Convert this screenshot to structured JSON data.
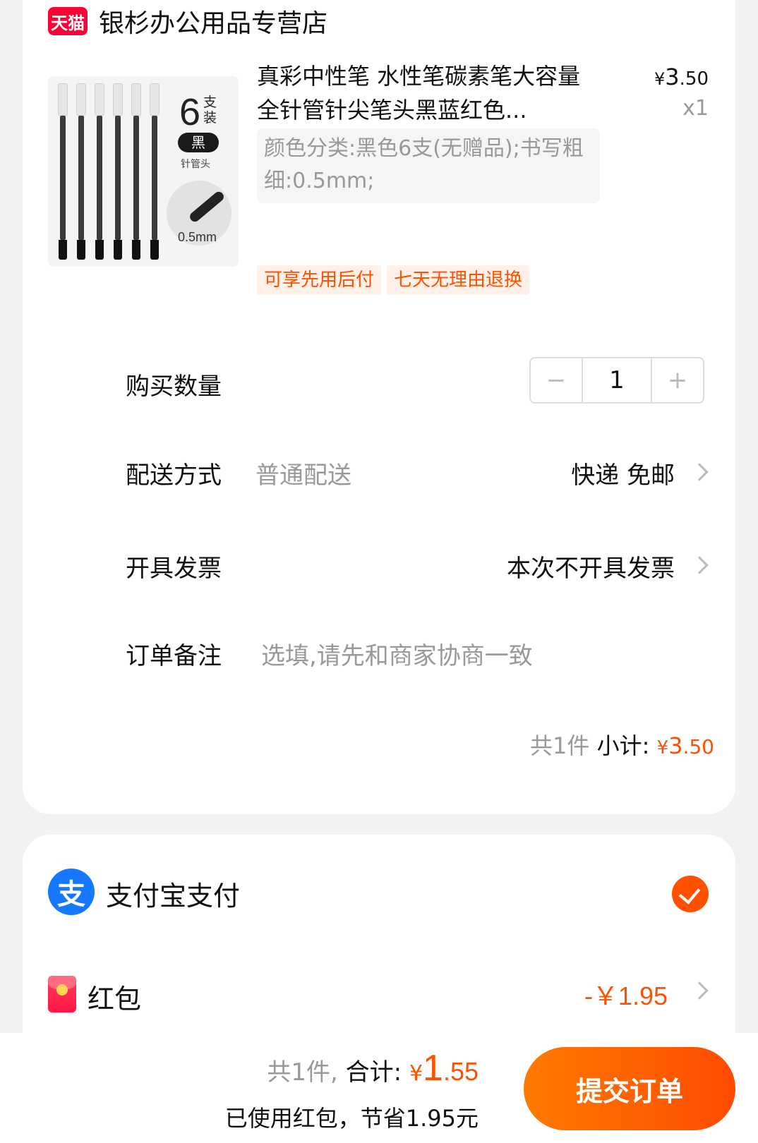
{
  "store": {
    "badge": "天猫",
    "name": "银杉办公用品专营店"
  },
  "product": {
    "image": {
      "count": "6",
      "count_unit": "支装",
      "color": "黑",
      "needle": "针管头",
      "size": "0.5mm"
    },
    "title": "真彩中性笔 水性笔碳素笔大容量全针管针尖笔头黑蓝红色...",
    "price": {
      "symbol": "¥",
      "int": "3",
      "dec": ".50"
    },
    "qty": "x1",
    "sku": "颜色分类:黑色6支(无赠品);书写粗细:0.5mm;",
    "tags": [
      "可享先用后付",
      "七天无理由退换"
    ]
  },
  "quantity": {
    "label": "购买数量",
    "value": "1",
    "minus": "−",
    "plus": "+"
  },
  "delivery": {
    "label": "配送方式",
    "method": "普通配送",
    "value": "快递 免邮"
  },
  "invoice": {
    "label": "开具发票",
    "value": "本次不开具发票"
  },
  "note": {
    "label": "订单备注",
    "placeholder": "选填,请先和商家协商一致"
  },
  "subtotal": {
    "count": "共1件",
    "label": "小计:",
    "symbol": "¥",
    "int": "3",
    "dec": ".50"
  },
  "payment": {
    "logo": "支",
    "method": "支付宝支付",
    "redpacket_label": "红包",
    "redpacket_value": "-￥1.95"
  },
  "footer": {
    "count": "共1件,",
    "total_label": "合计:",
    "symbol": "¥",
    "int": "1",
    "dec": ".55",
    "saved": "已使用红包，节省1.95元",
    "submit": "提交订单"
  },
  "colors": {
    "accent": "#ff5000",
    "tmall": "#ff0036",
    "alipay": "#1677ff"
  }
}
